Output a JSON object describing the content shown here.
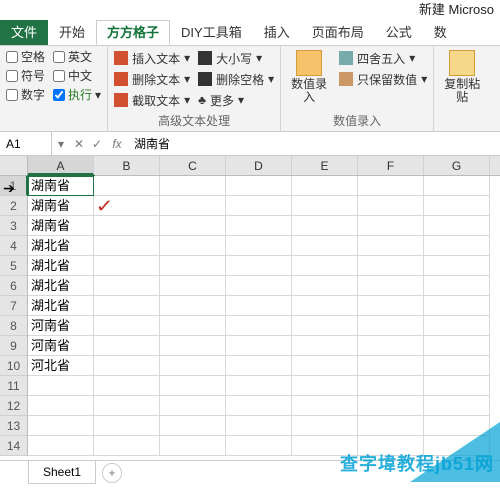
{
  "title": "新建 Microso",
  "tabs": {
    "file": "文件",
    "start": "开始",
    "ffgz": "方方格子",
    "diy": "DIY工具箱",
    "insert": "插入",
    "layout": "页面布局",
    "formula": "公式",
    "data": "数"
  },
  "groupA": {
    "blank": "空格",
    "symbol": "符号",
    "number": "数字",
    "en": "英文",
    "cn": "中文",
    "exec": "执行"
  },
  "groupB": {
    "insText": "插入文本",
    "delText": "删除文本",
    "crop": "截取文本",
    "case": "大小写",
    "delSpace": "删除空格",
    "more": "更多",
    "label": "高级文本处理"
  },
  "groupC": {
    "numIn": "数值录\n入",
    "round": "四舍五入",
    "keepNum": "只保留数值",
    "label": "数值录入"
  },
  "groupD": {
    "paste": "复制粘\n贴"
  },
  "formulaBar": {
    "ref": "A1",
    "value": "湖南省"
  },
  "cols": [
    "A",
    "B",
    "C",
    "D",
    "E",
    "F",
    "G"
  ],
  "rowsShown": 14,
  "cells": {
    "1": "湖南省",
    "2": "湖南省",
    "3": "湖南省",
    "4": "湖北省",
    "5": "湖北省",
    "6": "湖北省",
    "7": "湖北省",
    "8": "河南省",
    "9": "河南省",
    "10": "河北省"
  },
  "sheet": {
    "name": "Sheet1"
  },
  "watermark": "查字㙔教程jb51网"
}
